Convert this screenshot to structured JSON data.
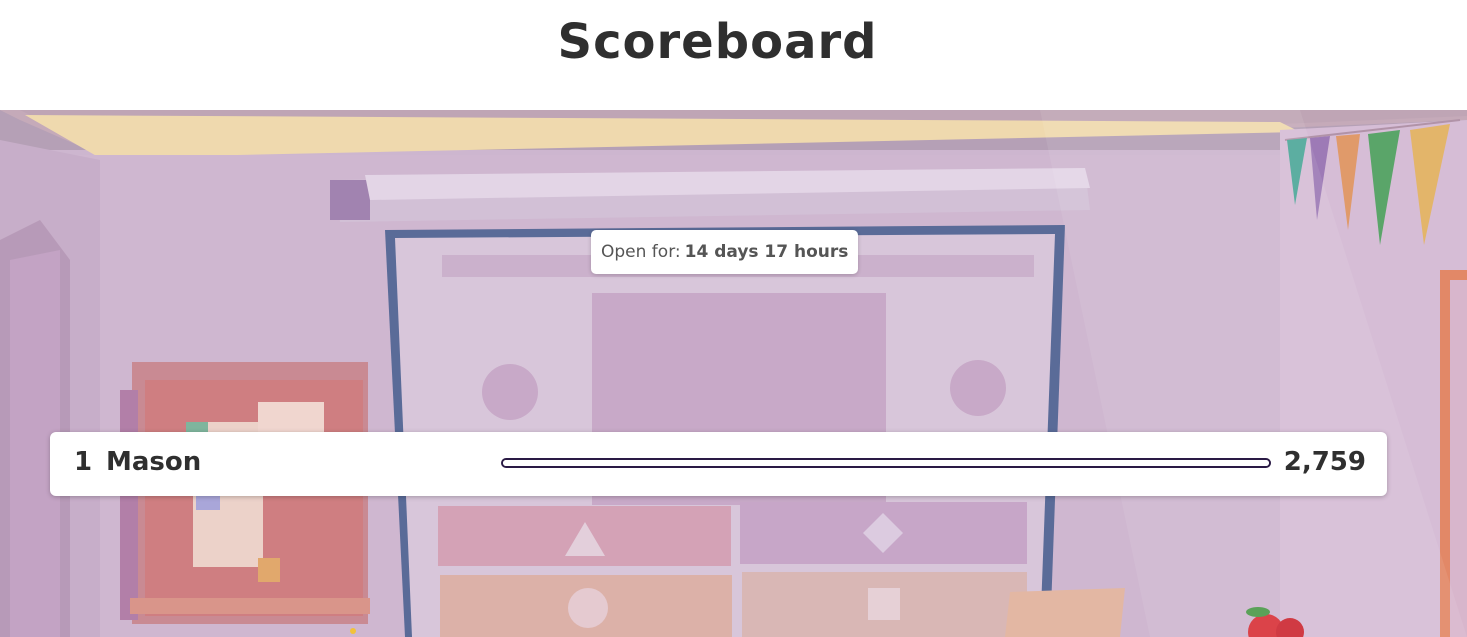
{
  "page": {
    "title": "Scoreboard"
  },
  "timer": {
    "label": "Open for:",
    "value": "14 days 17 hours"
  },
  "leaderboard": {
    "rows": [
      {
        "rank": "1",
        "name": "Mason",
        "score": "2,759",
        "progress": 1.0
      }
    ]
  },
  "theme": {
    "text_color": "#2f2f2f",
    "progress_border": "#2a1a45",
    "background_tint": "#cdb6cf"
  },
  "icons": [
    "bunting-flags",
    "apple-icon",
    "classroom-background"
  ]
}
